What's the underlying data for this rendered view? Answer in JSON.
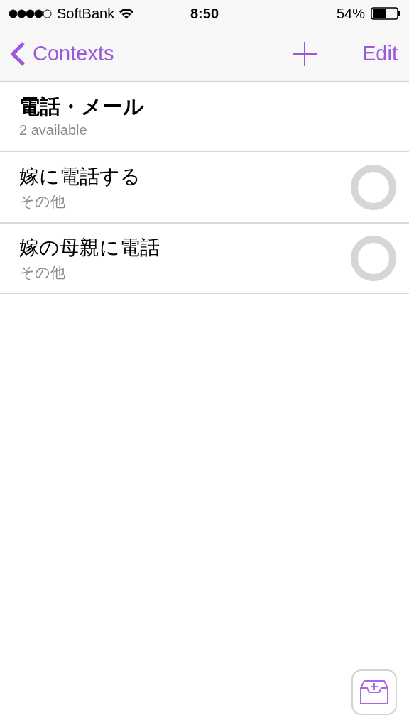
{
  "status_bar": {
    "carrier": "SoftBank",
    "time": "8:50",
    "battery": "54%"
  },
  "nav_bar": {
    "back": "Contexts",
    "action": "Edit"
  },
  "section": {
    "title": "電話・メール",
    "subtitle": "2 available"
  },
  "tasks": [
    {
      "title": "嫁に電話する",
      "context": "その他",
      "checked": false
    },
    {
      "title": "嫁の母親に電話",
      "context": "その他",
      "checked": false
    }
  ]
}
